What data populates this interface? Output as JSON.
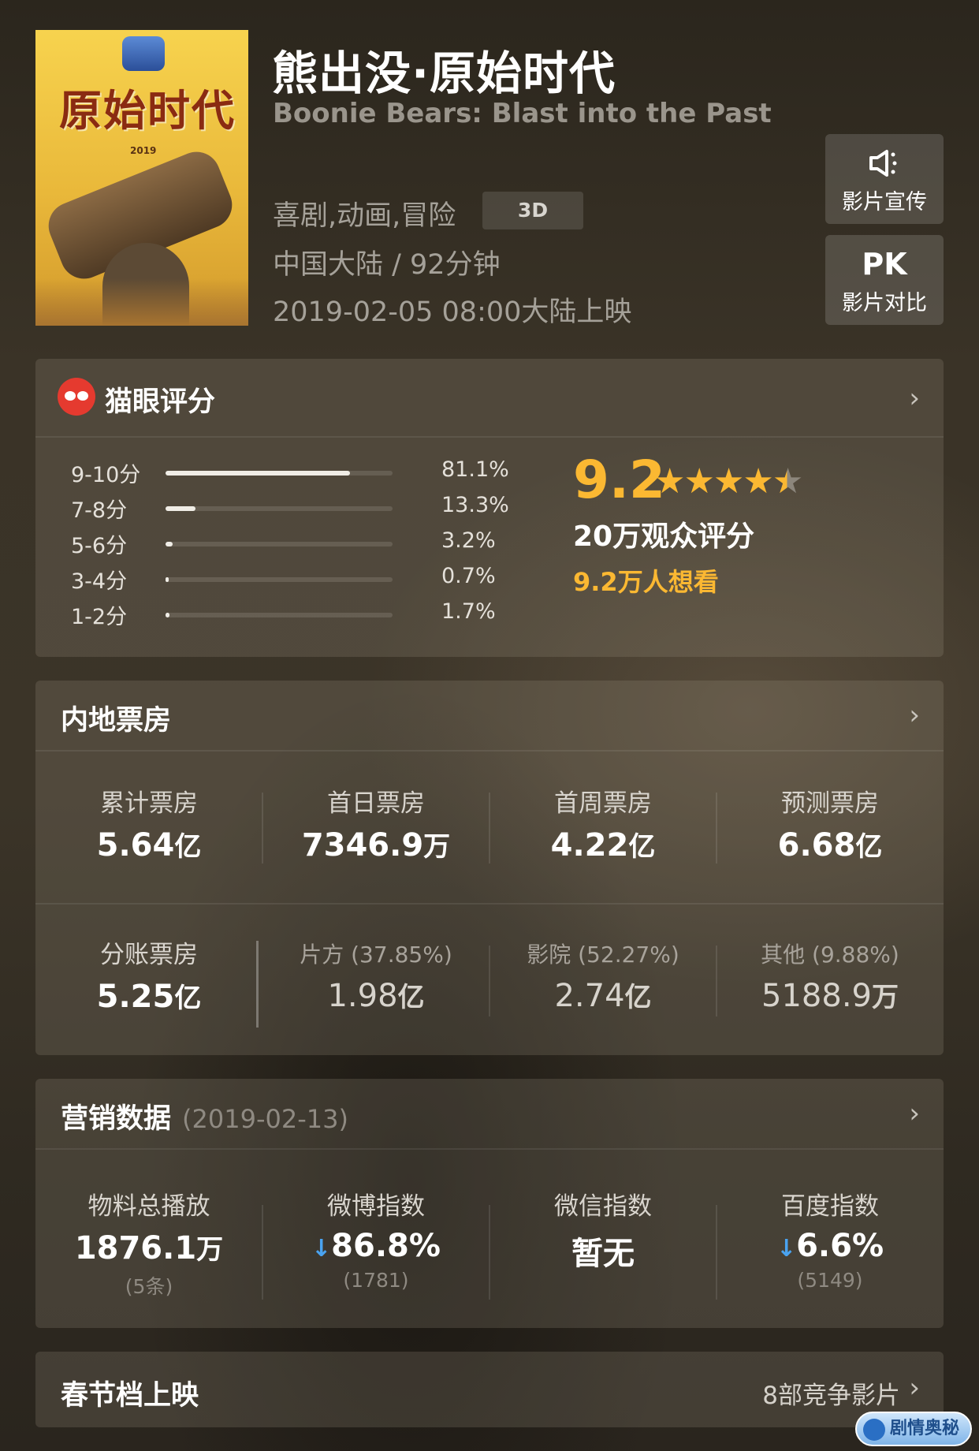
{
  "movie": {
    "title": "熊出没·原始时代",
    "english_title": "Boonie Bears: Blast into the Past",
    "genres": "喜剧,动画,冒险",
    "format": "3D",
    "region_duration": "中国大陆 / 92分钟",
    "release": "2019-02-05 08:00大陆上映",
    "poster_text": "原始时代",
    "poster_year": "2019"
  },
  "side_buttons": [
    {
      "icon": "speaker-icon",
      "label": "影片宣传"
    },
    {
      "icon_text": "PK",
      "label": "影片对比"
    }
  ],
  "rating": {
    "title": "猫眼评分",
    "score": "9.2",
    "stars": 4.5,
    "count_label": "20万观众评分",
    "want_label": "9.2万人想看",
    "distribution": [
      {
        "label": "9-10分",
        "percent": "81.1%",
        "value": 81.1
      },
      {
        "label": "7-8分",
        "percent": "13.3%",
        "value": 13.3
      },
      {
        "label": "5-6分",
        "percent": "3.2%",
        "value": 3.2
      },
      {
        "label": "3-4分",
        "percent": "0.7%",
        "value": 0.7
      },
      {
        "label": "1-2分",
        "percent": "1.7%",
        "value": 1.7
      }
    ]
  },
  "box_office": {
    "title": "内地票房",
    "top": [
      {
        "label": "累计票房",
        "value": "5.64",
        "unit": "亿"
      },
      {
        "label": "首日票房",
        "value": "7346.9",
        "unit": "万"
      },
      {
        "label": "首周票房",
        "value": "4.22",
        "unit": "亿"
      },
      {
        "label": "预测票房",
        "value": "6.68",
        "unit": "亿"
      }
    ],
    "split": {
      "label": "分账票房",
      "value": "5.25",
      "unit": "亿"
    },
    "split_parts": [
      {
        "label": "片方 (37.85%)",
        "value": "1.98",
        "unit": "亿"
      },
      {
        "label": "影院 (52.27%)",
        "value": "2.74",
        "unit": "亿"
      },
      {
        "label": "其他 (9.88%)",
        "value": "5188.9",
        "unit": "万"
      }
    ]
  },
  "marketing": {
    "title": "营销数据",
    "date": "(2019-02-13)",
    "items": [
      {
        "label": "物料总播放",
        "value": "1876.1",
        "unit": "万",
        "sub": "(5条)",
        "arrow": ""
      },
      {
        "label": "微博指数",
        "value": "86.8%",
        "unit": "",
        "sub": "(1781)",
        "arrow": "↓"
      },
      {
        "label": "微信指数",
        "value": "暂无",
        "unit": "",
        "sub": "",
        "arrow": ""
      },
      {
        "label": "百度指数",
        "value": "6.6%",
        "unit": "",
        "sub": "(5149)",
        "arrow": "↓"
      }
    ]
  },
  "festival": {
    "title": "春节档上映",
    "right": "8部竞争影片"
  },
  "watermark": "剧情奥秘",
  "colors": {
    "accent": "#fbb832",
    "down_arrow": "#4aa3f0",
    "maoyan_red": "#e53a2f"
  }
}
